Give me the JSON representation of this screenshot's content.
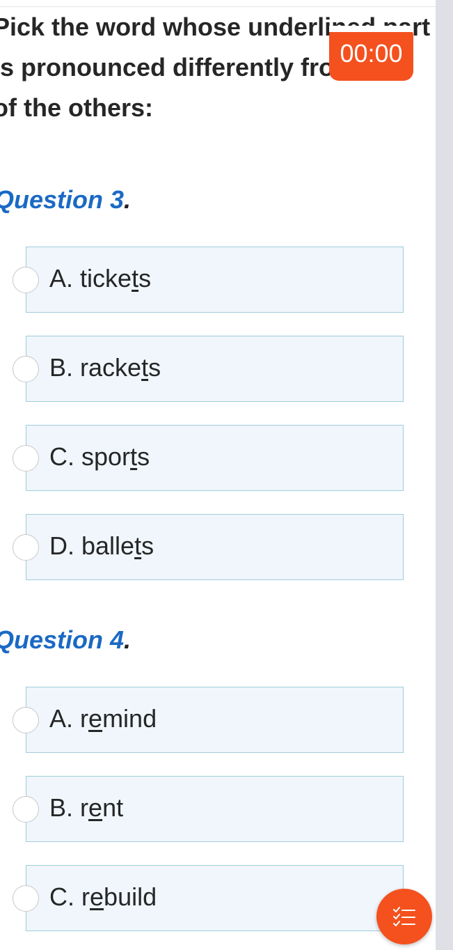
{
  "instruction": "Pick the word whose underlined part is pronounced differently from that of the others:",
  "timer": "00:00",
  "questions": [
    {
      "title": "Question 3",
      "dot": ".",
      "options": [
        {
          "letter": "A.",
          "pre": "ticke",
          "u": "t",
          "post": "s"
        },
        {
          "letter": "B.",
          "pre": "racke",
          "u": "t",
          "post": "s"
        },
        {
          "letter": "C.",
          "pre": "spor",
          "u": "t",
          "post": "s"
        },
        {
          "letter": "D.",
          "pre": "balle",
          "u": "t",
          "post": "s"
        }
      ]
    },
    {
      "title": "Question 4",
      "dot": ".",
      "options": [
        {
          "letter": "A.",
          "pre": "r",
          "u": "e",
          "post": "mind"
        },
        {
          "letter": "B.",
          "pre": "r",
          "u": "e",
          "post": "nt"
        },
        {
          "letter": "C.",
          "pre": "r",
          "u": "e",
          "post": "build"
        }
      ]
    }
  ],
  "fab_icon": "checklist-icon",
  "colors": {
    "accent": "#f4511e",
    "question_title": "#1a6ac4",
    "option_bg": "#f0f6fc",
    "option_border": "#9fcdd9"
  }
}
